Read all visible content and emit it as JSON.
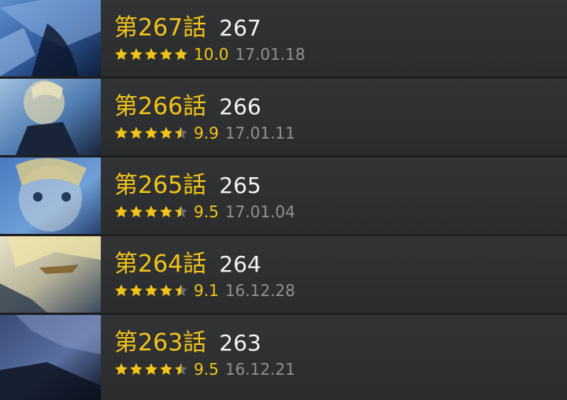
{
  "episodes": [
    {
      "title": "第267話",
      "number": "267",
      "rating": "10.0",
      "stars": 5.0,
      "date": "17.01.18"
    },
    {
      "title": "第266話",
      "number": "266",
      "rating": "9.9",
      "stars": 4.5,
      "date": "17.01.11"
    },
    {
      "title": "第265話",
      "number": "265",
      "rating": "9.5",
      "stars": 4.5,
      "date": "17.01.04"
    },
    {
      "title": "第264話",
      "number": "264",
      "rating": "9.1",
      "stars": 4.5,
      "date": "16.12.28"
    },
    {
      "title": "第263話",
      "number": "263",
      "rating": "9.5",
      "stars": 4.5,
      "date": "16.12.21"
    }
  ],
  "colors": {
    "accent": "#f2c318",
    "row_background": "#2e3032",
    "date_text": "#8e9194",
    "number_text": "#f4f4f4"
  }
}
